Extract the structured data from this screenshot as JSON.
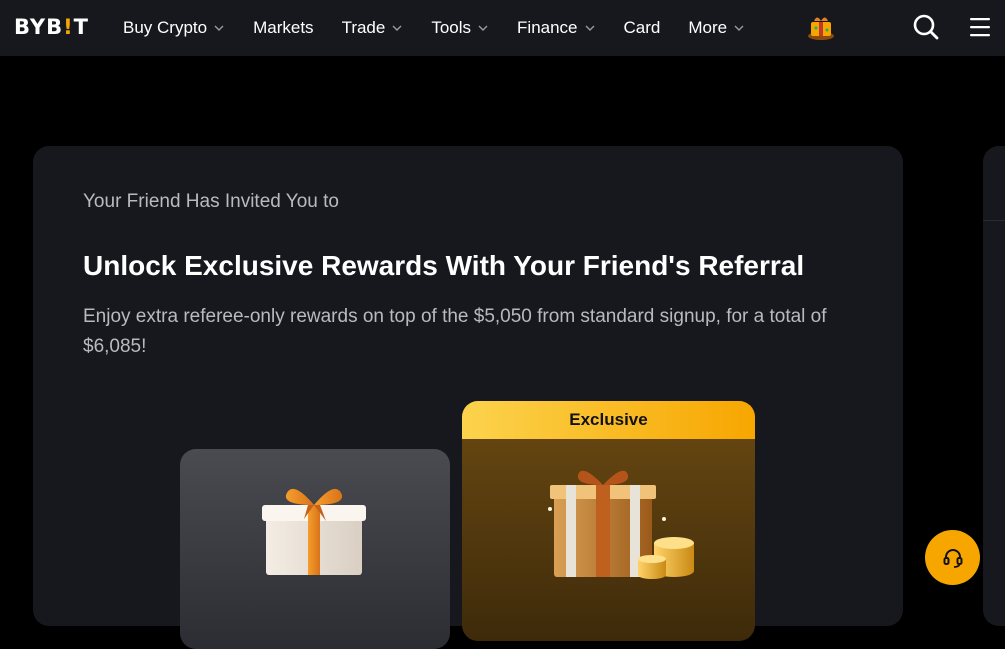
{
  "brand": {
    "logo_left": "BYB",
    "logo_mark": "!",
    "logo_right": "T",
    "accent_color": "#f7a600"
  },
  "nav": {
    "items": [
      {
        "label": "Buy Crypto",
        "has_dropdown": true
      },
      {
        "label": "Markets",
        "has_dropdown": false
      },
      {
        "label": "Trade",
        "has_dropdown": true
      },
      {
        "label": "Tools",
        "has_dropdown": true
      },
      {
        "label": "Finance",
        "has_dropdown": true
      },
      {
        "label": "Card",
        "has_dropdown": false
      },
      {
        "label": "More",
        "has_dropdown": true
      }
    ],
    "icons": [
      "promo-gift-icon",
      "search-icon",
      "hamburger-menu-icon"
    ]
  },
  "hero": {
    "invite_text": "Your Friend Has Invited You to",
    "headline": "Unlock Exclusive Rewards With Your Friend's Referral",
    "subtext": "Enjoy extra referee-only rewards on top of the $5,050 from standard signup, for a total of $6,085!"
  },
  "rewards": {
    "exclusive_badge": "Exclusive",
    "basic_icon": "gift-box-icon",
    "exclusive_icon": "gift-box-with-coins-icon"
  },
  "support": {
    "icon": "headset-icon"
  }
}
